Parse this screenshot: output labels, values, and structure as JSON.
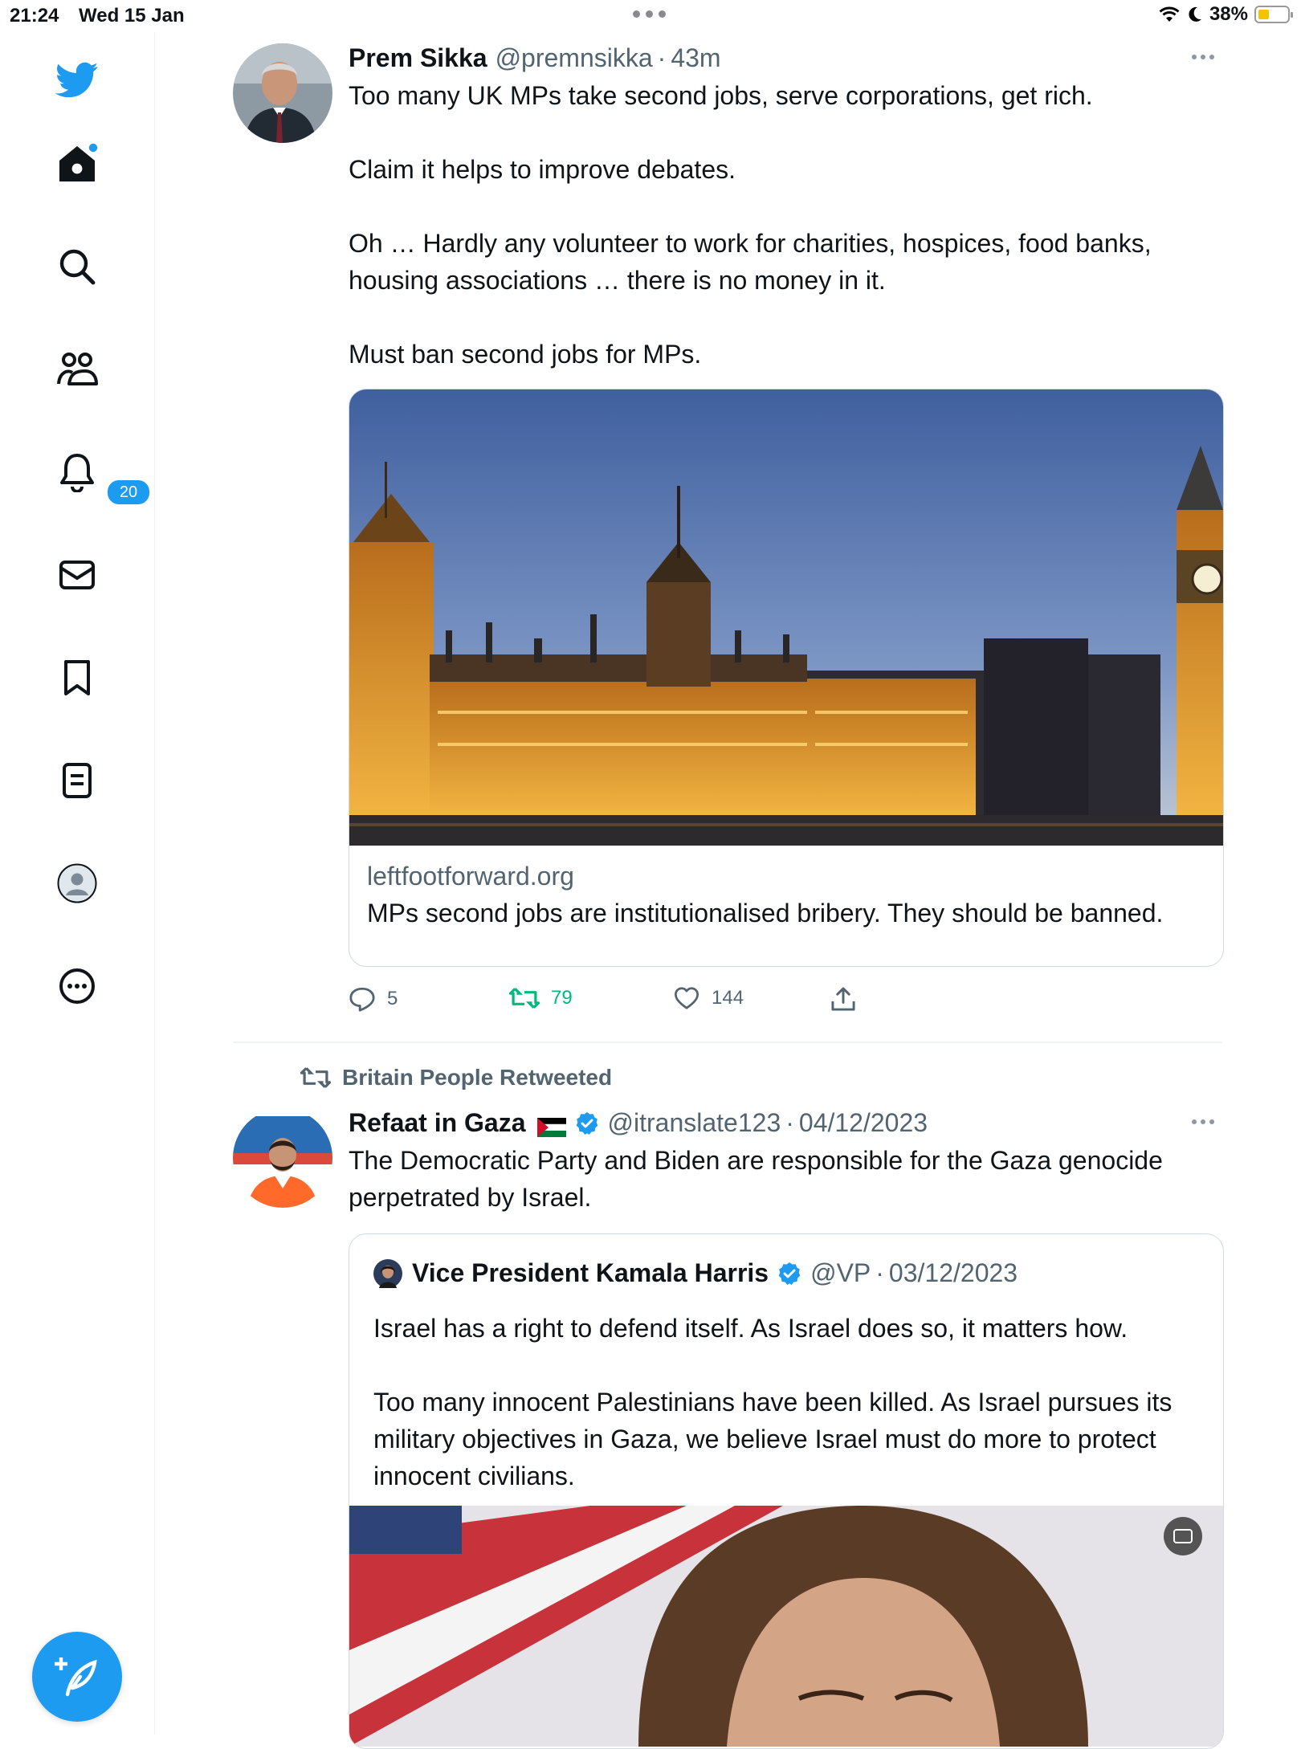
{
  "status_bar": {
    "time": "21:24",
    "date": "Wed 15 Jan",
    "battery": "38%",
    "battery_level": 0.38
  },
  "sidebar": {
    "notifications_badge": "20",
    "items": [
      "twitter-logo",
      "home",
      "explore",
      "communities",
      "notifications",
      "messages",
      "bookmarks",
      "lists",
      "profile",
      "more"
    ]
  },
  "tweet1": {
    "name": "Prem Sikka",
    "handle": "@premnsikka",
    "time": "43m",
    "text": "Too many UK MPs take second jobs, serve corporations, get rich.\n\nClaim it helps to improve debates.\n\nOh … Hardly any volunteer to work for charities, hospices, food banks, housing associations … there is no money in it.\n\nMust ban second jobs for MPs.",
    "card": {
      "domain": "leftfootforward.org",
      "title": "MPs second jobs are institutionalised bribery. They should be banned."
    },
    "replies": "5",
    "retweets": "79",
    "likes": "144"
  },
  "tweet2": {
    "retweeted_by": "Britain People Retweeted",
    "name": "Refaat in Gaza",
    "handle": "@itranslate123",
    "time": "04/12/2023",
    "text": "The Democratic Party and Biden are responsible for the Gaza genocide perpetrated by Israel.",
    "quote": {
      "name": "Vice President Kamala Harris",
      "handle": "@VP",
      "time": "03/12/2023",
      "text": "Israel has a right to defend itself. As Israel does so, it matters how.\n\nToo many innocent Palestinians have been killed. As Israel pursues its military objectives in Gaza, we believe Israel must do more to protect innocent civilians."
    }
  },
  "colors": {
    "accent": "#1d9bf0",
    "retweet": "#00ba7c",
    "secondary_text": "#536471"
  }
}
